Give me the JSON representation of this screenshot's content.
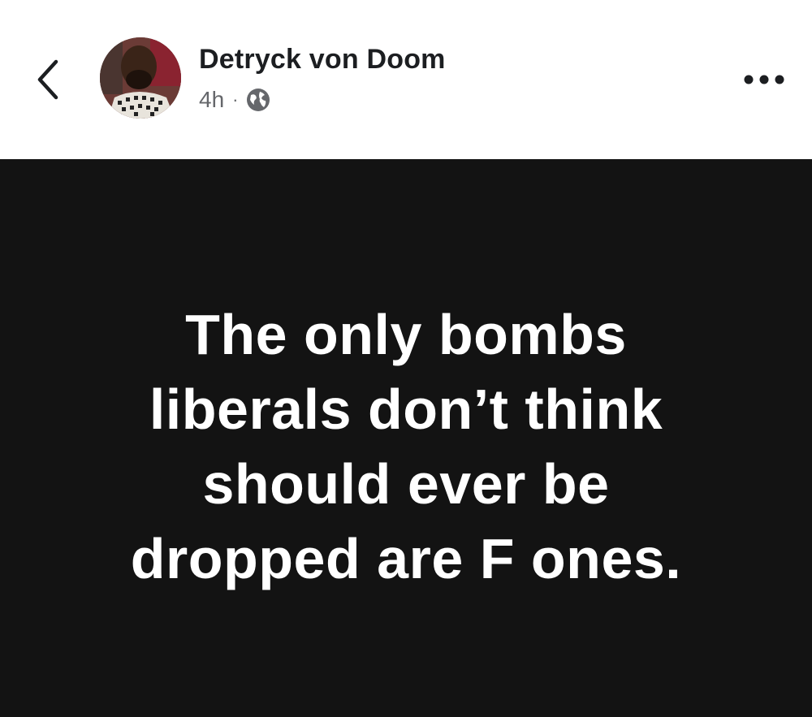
{
  "header": {
    "author_name": "Detryck von Doom",
    "timestamp": "4h",
    "separator": "·",
    "audience_icon": "globe-icon",
    "back_icon": "chevron-left-icon",
    "more_icon": "more-options-icon"
  },
  "post": {
    "text": "The only bombs\nliberals don’t think\nshould ever be\ndropped are F ones."
  },
  "colors": {
    "header_bg": "#ffffff",
    "post_bg": "#131313",
    "post_text": "#ffffff",
    "name_text": "#1c1e21",
    "meta_text": "#65676b"
  }
}
